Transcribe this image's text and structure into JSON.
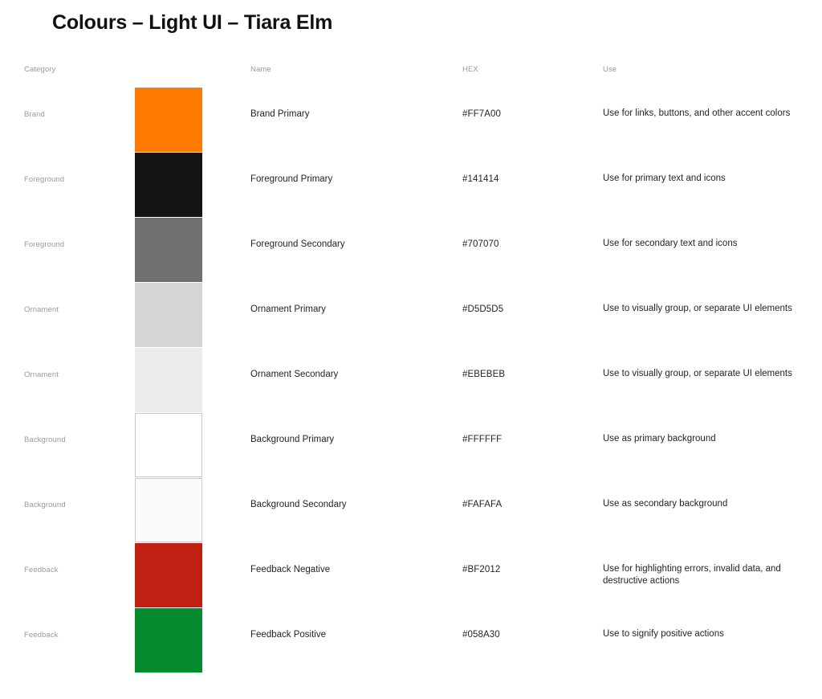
{
  "page": {
    "title": "Colours – Light UI – Tiara Elm",
    "background": "#FFFFFF"
  },
  "table": {
    "headers": {
      "category": "Category",
      "swatch": "",
      "name": "Name",
      "hex": "HEX",
      "use": "Use"
    },
    "rows": [
      {
        "category": "Brand",
        "name": "Brand Primary",
        "hex": "#FF7A00",
        "use": "Use for links, buttons, and other accent colors",
        "swatch_color": "#FF7A00",
        "bordered": false
      },
      {
        "category": "Foreground",
        "name": "Foreground Primary",
        "hex": "#141414",
        "use": "Use for primary text and icons",
        "swatch_color": "#141414",
        "bordered": false
      },
      {
        "category": "Foreground",
        "name": "Foreground Secondary",
        "hex": "#707070",
        "use": "Use for secondary text and icons",
        "swatch_color": "#707070",
        "bordered": false
      },
      {
        "category": "Ornament",
        "name": "Ornament Primary",
        "hex": "#D5D5D5",
        "use": "Use to visually group, or separate UI elements",
        "swatch_color": "#D5D5D5",
        "bordered": false
      },
      {
        "category": "Ornament",
        "name": "Ornament Secondary",
        "hex": "#EBEBEB",
        "use": "Use to visually group, or separate UI elements",
        "swatch_color": "#EBEBEB",
        "bordered": false
      },
      {
        "category": "Background",
        "name": "Background Primary",
        "hex": "#FFFFFF",
        "use": "Use as primary background",
        "swatch_color": "#FFFFFF",
        "bordered": true
      },
      {
        "category": "Background",
        "name": "Background Secondary",
        "hex": "#FAFAFA",
        "use": "Use as secondary background",
        "swatch_color": "#FAFAFA",
        "bordered": true
      },
      {
        "category": "Feedback",
        "name": "Feedback Negative",
        "hex": "#BF2012",
        "use": "Use for highlighting errors, invalid data, and destructive actions",
        "swatch_color": "#BF2012",
        "bordered": false
      },
      {
        "category": "Feedback",
        "name": "Feedback Positive",
        "hex": "#058A30",
        "use": "Use to signify positive actions",
        "swatch_color": "#058A30",
        "bordered": false
      }
    ]
  }
}
